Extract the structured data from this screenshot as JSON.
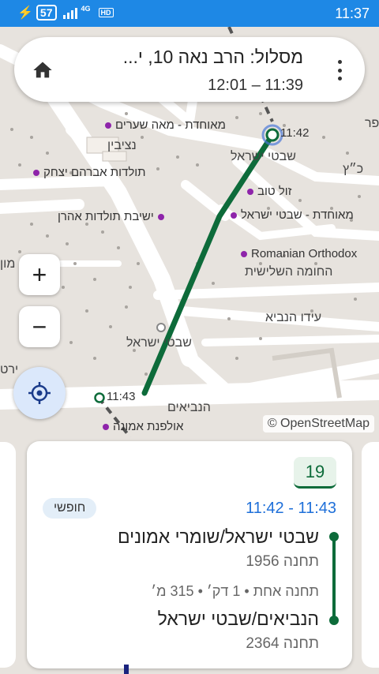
{
  "status_bar": {
    "battery": "57",
    "network": "4G",
    "hd": "HD",
    "time": "11:37"
  },
  "route_header": {
    "title": "מסלול: הרב נאה 10, י...",
    "subtitle": "12:01 – 11:39"
  },
  "map": {
    "labels": [
      "נציבין",
      "שבטי ישראל",
      "כ״ץ",
      "החומה השלישית",
      "עידו הנביא",
      "שבטי ישראל",
      "הנביאים",
      "מון",
      "ירט",
      "פר"
    ],
    "pois": [
      "מאוחדת - מאה שערים",
      "תולדות אברהם יצחק",
      "ישיבת תולדות אהרן",
      "זול טוב",
      "מאוחדת - שבטי ישראל",
      "Romanian Orthodox",
      "אולפנת אמונה"
    ],
    "stop_times": [
      "11:42",
      "11:43"
    ],
    "attribution": "© OpenStreetMap",
    "colors": {
      "route": "#0d6b3a",
      "poi": "#8e24aa",
      "accent": "#1e88e5"
    }
  },
  "controls": {
    "zoom_in": "+",
    "zoom_out": "−"
  },
  "trip": {
    "line": "19",
    "times": "11:42 - 11:43",
    "fare": "חופשי",
    "from_stop": "שבטי ישראל/שומרי אמונים",
    "from_code": "תחנה 1956",
    "info": "תחנה אחת • 1 דק׳ • 315 מ׳",
    "to_stop": "הנביאים/שבטי ישראל",
    "to_code": "תחנה 2364"
  }
}
